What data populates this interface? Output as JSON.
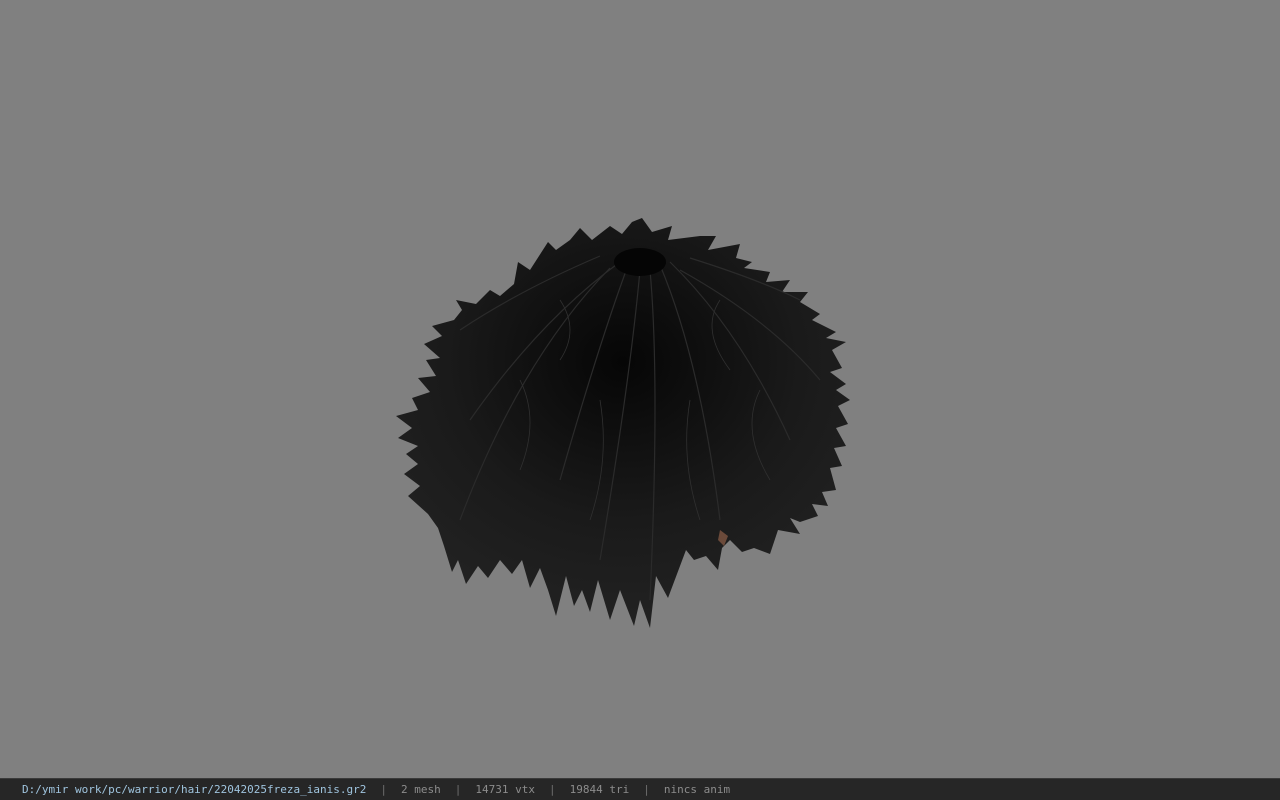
{
  "viewer": {
    "background_color": "#808080",
    "model_subject": "black spiky hair mesh",
    "model_color": "#161616"
  },
  "status_bar": {
    "file_path": "D:/ymir work/pc/warrior/hair/22042025freza_ianis.gr2",
    "separator": "|",
    "mesh_count": "2 mesh",
    "vertex_count": "14731 vtx",
    "triangle_count": "19844 tri",
    "anim_status": "nincs anim",
    "path_color": "#9fc4de",
    "text_color": "#8c8c8c"
  }
}
